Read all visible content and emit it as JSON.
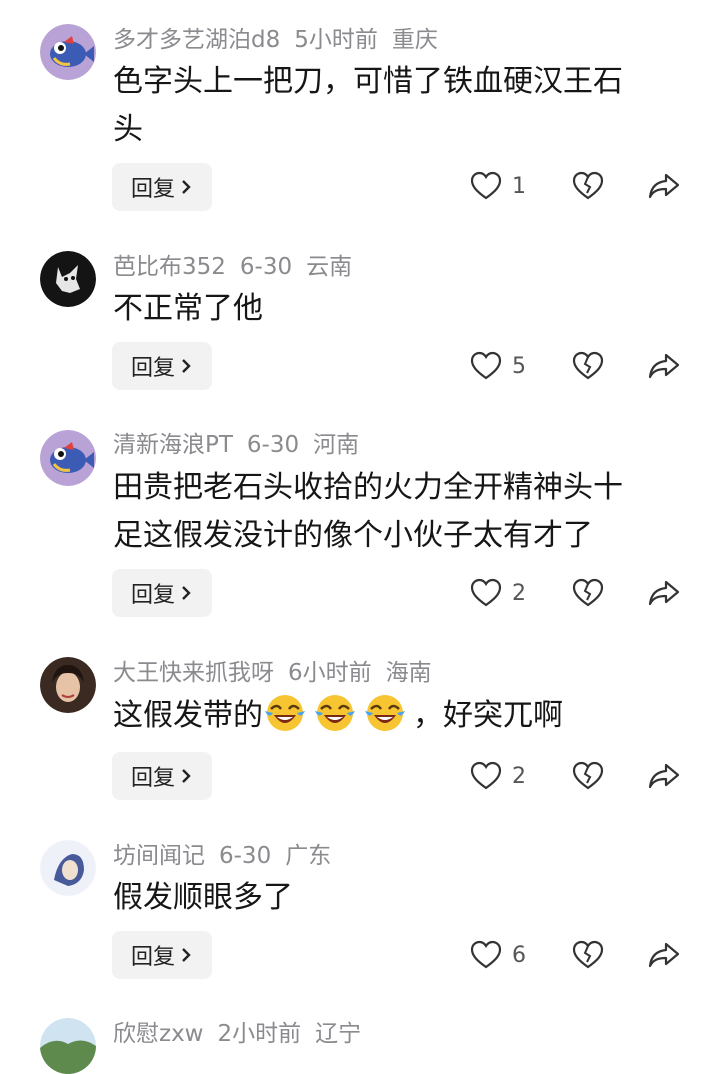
{
  "comments": [
    {
      "username": "多才多艺湖泊d8",
      "time": "5小时前",
      "location": "重庆",
      "text_lines": [
        "色字头上一把刀，可惜了铁血硬汉王石",
        "头"
      ],
      "reply_label": "回复",
      "likes": "1",
      "avatar_color": "#b9a3d6"
    },
    {
      "username": "芭比布352",
      "time": "6-30",
      "location": "云南",
      "text_lines": [
        "不正常了他"
      ],
      "reply_label": "回复",
      "likes": "5",
      "avatar_color": "#1a1a1a"
    },
    {
      "username": "清新海浪PT",
      "time": "6-30",
      "location": "河南",
      "text_lines": [
        "田贵把老石头收拾的火力全开精神头十",
        "足这假发没计的像个小伙子太有才了"
      ],
      "reply_label": "回复",
      "likes": "2",
      "avatar_color": "#b9a3d6"
    },
    {
      "username": "大王快来抓我呀",
      "time": "6小时前",
      "location": "海南",
      "text_before_emoji": "这假发带的",
      "text_after_emoji": "，好突兀啊",
      "emoji_count": 3,
      "reply_label": "回复",
      "likes": "2",
      "avatar_color": "#6b4a3a"
    },
    {
      "username": "坊间闻记",
      "time": "6-30",
      "location": "广东",
      "text_lines": [
        "假发顺眼多了"
      ],
      "reply_label": "回复",
      "likes": "6",
      "avatar_color": "#e8eef6"
    },
    {
      "username": "欣慰zxw",
      "time": "2小时前",
      "location": "辽宁",
      "avatar_color": "#6a8a5a"
    }
  ],
  "icons": {
    "like": "heart-outline-icon",
    "dislike": "broken-heart-icon",
    "share": "share-arrow-icon",
    "reply_chevron": "chevron-right-icon"
  },
  "colors": {
    "meta_text": "#8a8a8f",
    "reply_bg": "#f2f2f2"
  }
}
